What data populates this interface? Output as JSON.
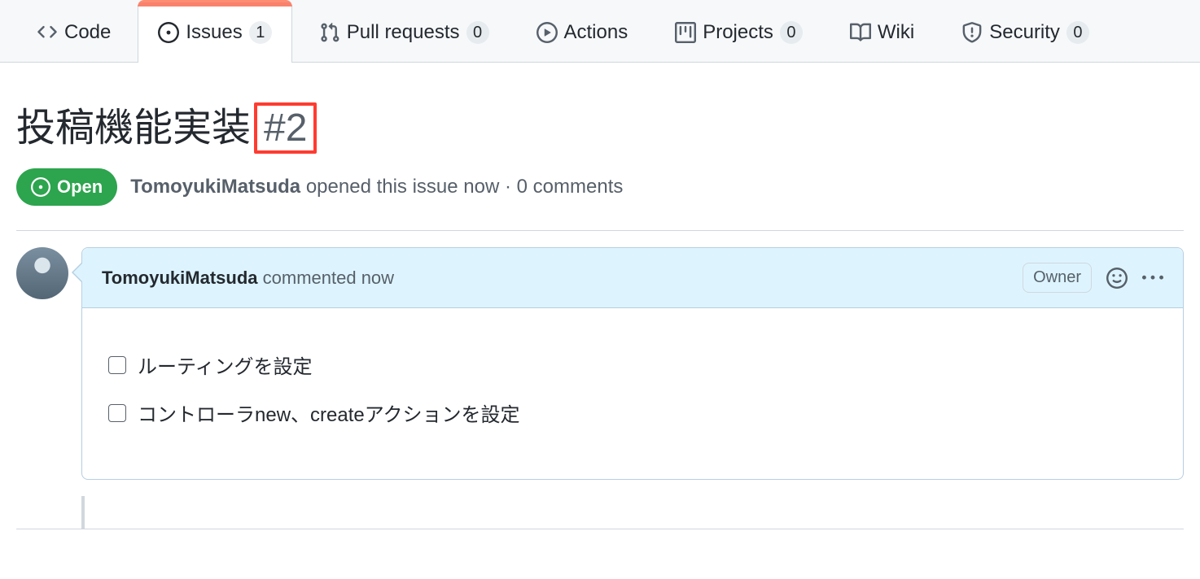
{
  "nav": {
    "code": {
      "label": "Code"
    },
    "issues": {
      "label": "Issues",
      "count": "1"
    },
    "pull_requests": {
      "label": "Pull requests",
      "count": "0"
    },
    "actions": {
      "label": "Actions"
    },
    "projects": {
      "label": "Projects",
      "count": "0"
    },
    "wiki": {
      "label": "Wiki"
    },
    "security": {
      "label": "Security",
      "count": "0"
    }
  },
  "issue": {
    "title": "投稿機能実装",
    "number": "#2",
    "state_label": "Open",
    "author": "TomoyukiMatsuda",
    "opened_text": "opened this issue now · 0 comments"
  },
  "comment": {
    "author": "TomoyukiMatsuda",
    "commented_text": "commented now",
    "owner_label": "Owner",
    "tasks": [
      "ルーティングを設定",
      "コントローラnew、createアクションを設定"
    ]
  }
}
